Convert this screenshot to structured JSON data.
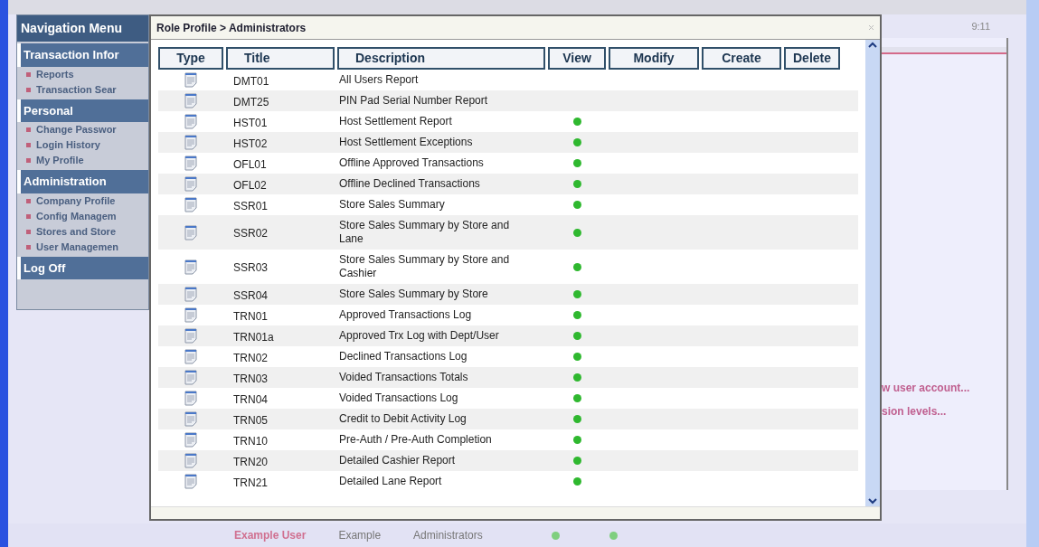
{
  "nav": {
    "title": "Navigation Menu",
    "sections": [
      {
        "label": "Transaction Infor",
        "items": [
          "Reports",
          "Transaction Sear"
        ]
      },
      {
        "label": "Personal",
        "items": [
          "Change Passwor",
          "Login History",
          "My Profile"
        ]
      },
      {
        "label": "Administration",
        "items": [
          "Company Profile",
          "Config Managem",
          "Stores and Store",
          "User Managemen"
        ]
      },
      {
        "label": "Log Off"
      }
    ]
  },
  "clock": "9:11",
  "dialog": {
    "title": "Role Profile > Administrators",
    "columns": [
      "Type",
      "Title",
      "Description",
      "View",
      "Modify",
      "Create",
      "Delete"
    ],
    "rows": [
      {
        "kind": "report",
        "title": "DMT01",
        "description": "All Users Report",
        "view": false
      },
      {
        "kind": "report",
        "title": "DMT25",
        "description": "PIN Pad Serial Number Report",
        "view": false
      },
      {
        "kind": "report",
        "title": "HST01",
        "description": "Host Settlement Report",
        "view": true
      },
      {
        "kind": "report",
        "title": "HST02",
        "description": "Host Settlement Exceptions",
        "view": true
      },
      {
        "kind": "report",
        "title": "OFL01",
        "description": "Offline Approved Transactions",
        "view": true
      },
      {
        "kind": "report",
        "title": "OFL02",
        "description": "Offline Declined Transactions",
        "view": true
      },
      {
        "kind": "report",
        "title": "SSR01",
        "description": "Store Sales Summary",
        "view": true
      },
      {
        "kind": "report",
        "title": "SSR02",
        "description": "Store Sales Summary by Store and Lane",
        "view": true
      },
      {
        "kind": "report",
        "title": "SSR03",
        "description": "Store Sales Summary by Store and Cashier",
        "view": true
      },
      {
        "kind": "report",
        "title": "SSR04",
        "description": "Store Sales Summary by Store",
        "view": true
      },
      {
        "kind": "report",
        "title": "TRN01",
        "description": "Approved Transactions Log",
        "view": true
      },
      {
        "kind": "report",
        "title": "TRN01a",
        "description": "Approved Trx Log with Dept/User",
        "view": true
      },
      {
        "kind": "report",
        "title": "TRN02",
        "description": "Declined Transactions Log",
        "view": true
      },
      {
        "kind": "report",
        "title": "TRN03",
        "description": "Voided Transactions Totals",
        "view": true
      },
      {
        "kind": "report",
        "title": "TRN04",
        "description": "Voided Transactions Log",
        "view": true
      },
      {
        "kind": "report",
        "title": "TRN05",
        "description": "Credit to Debit Activity Log",
        "view": true
      },
      {
        "kind": "report",
        "title": "TRN10",
        "description": "Pre-Auth / Pre-Auth Completion",
        "view": true
      },
      {
        "kind": "report",
        "title": "TRN20",
        "description": "Detailed Cashier Report",
        "view": true
      },
      {
        "kind": "report",
        "title": "TRN21",
        "description": "Detailed Lane Report",
        "view": true
      }
    ]
  },
  "background_links": [
    "w user account...",
    "sion levels..."
  ],
  "background_row": {
    "user": "Example User",
    "name": "Example",
    "role": "Administrators",
    "flags": [
      true,
      true
    ]
  }
}
